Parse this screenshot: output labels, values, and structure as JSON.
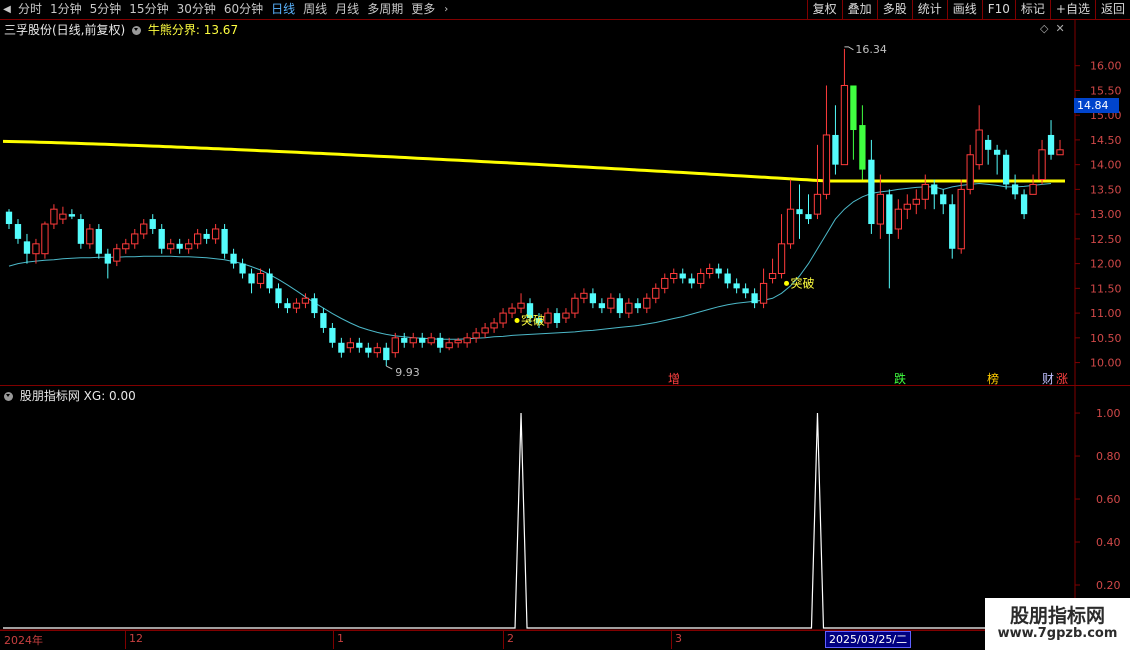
{
  "toolbar": {
    "periods": [
      "分时",
      "1分钟",
      "5分钟",
      "15分钟",
      "30分钟",
      "60分钟",
      "日线",
      "周线",
      "月线",
      "多周期",
      "更多"
    ],
    "active_period": "日线",
    "buttons": [
      "复权",
      "叠加",
      "多股",
      "统计",
      "画线",
      "F10",
      "标记",
      "+自选",
      "返回"
    ]
  },
  "main_panel": {
    "stock_title": "三孚股份(日线,前复权)",
    "indicator_label": "牛熊分界:",
    "indicator_value": "13.67",
    "high_label": "16.34",
    "low_label": "9.93",
    "current_price": "14.84",
    "breakout_labels": [
      "突破",
      "突破"
    ],
    "events": [
      "增",
      "跌",
      "榜",
      "财",
      "涨"
    ]
  },
  "sub_panel": {
    "title": "股朋指标网",
    "var_label": "XG: 0.00"
  },
  "date_axis": {
    "labels": [
      "2024年",
      "12",
      "1",
      "2",
      "3"
    ],
    "crosshair_date": "2025/03/25/二"
  },
  "watermark": {
    "name": "股朋指标网",
    "url": "www.7gpzb.com"
  },
  "colors": {
    "up": "#ff3c3c",
    "down": "#54fcfc",
    "bull_bear_line": "#ffff00",
    "ma_line": "#4cb8c8",
    "frame": "#800000"
  },
  "chart_data": [
    {
      "type": "candlestick",
      "y_ticks": [
        10.0,
        10.5,
        11.0,
        11.5,
        12.0,
        12.5,
        13.0,
        13.5,
        14.0,
        14.5,
        15.0,
        15.5,
        16.0
      ],
      "ylim": [
        9.85,
        16.6
      ],
      "bull_bear_line": {
        "start": 14.47,
        "end": 13.67
      },
      "candles": [
        [
          13.05,
          12.8,
          13.1,
          12.7
        ],
        [
          12.8,
          12.5,
          12.9,
          12.4
        ],
        [
          12.45,
          12.2,
          12.6,
          12.0
        ],
        [
          12.2,
          12.4,
          12.5,
          12.0
        ],
        [
          12.2,
          12.8,
          12.85,
          12.1
        ],
        [
          12.8,
          13.1,
          13.2,
          12.7
        ],
        [
          12.9,
          13.0,
          13.15,
          12.8
        ],
        [
          13.0,
          12.95,
          13.1,
          12.9
        ],
        [
          12.9,
          12.4,
          13.0,
          12.3
        ],
        [
          12.4,
          12.7,
          12.8,
          12.3
        ],
        [
          12.7,
          12.2,
          12.8,
          12.1
        ],
        [
          12.2,
          12.0,
          12.3,
          11.7
        ],
        [
          12.05,
          12.3,
          12.4,
          11.95
        ],
        [
          12.3,
          12.4,
          12.5,
          12.2
        ],
        [
          12.4,
          12.6,
          12.7,
          12.3
        ],
        [
          12.6,
          12.8,
          12.9,
          12.5
        ],
        [
          12.9,
          12.7,
          13.0,
          12.6
        ],
        [
          12.7,
          12.3,
          12.8,
          12.2
        ],
        [
          12.3,
          12.4,
          12.5,
          12.2
        ],
        [
          12.4,
          12.3,
          12.5,
          12.2
        ],
        [
          12.3,
          12.4,
          12.5,
          12.2
        ],
        [
          12.4,
          12.6,
          12.7,
          12.3
        ],
        [
          12.6,
          12.5,
          12.7,
          12.4
        ],
        [
          12.5,
          12.7,
          12.8,
          12.4
        ],
        [
          12.7,
          12.2,
          12.8,
          12.1
        ],
        [
          12.2,
          12.0,
          12.3,
          11.9
        ],
        [
          12.0,
          11.8,
          12.1,
          11.7
        ],
        [
          11.8,
          11.6,
          11.9,
          11.4
        ],
        [
          11.6,
          11.8,
          11.9,
          11.5
        ],
        [
          11.8,
          11.5,
          11.9,
          11.4
        ],
        [
          11.5,
          11.2,
          11.6,
          11.1
        ],
        [
          11.2,
          11.1,
          11.3,
          11.0
        ],
        [
          11.1,
          11.2,
          11.3,
          11.0
        ],
        [
          11.2,
          11.3,
          11.4,
          11.1
        ],
        [
          11.3,
          11.0,
          11.4,
          10.9
        ],
        [
          11.0,
          10.7,
          11.1,
          10.6
        ],
        [
          10.7,
          10.4,
          10.8,
          10.3
        ],
        [
          10.4,
          10.2,
          10.5,
          10.1
        ],
        [
          10.3,
          10.4,
          10.5,
          10.2
        ],
        [
          10.4,
          10.3,
          10.5,
          10.2
        ],
        [
          10.3,
          10.2,
          10.4,
          10.1
        ],
        [
          10.2,
          10.3,
          10.4,
          10.1
        ],
        [
          10.3,
          10.05,
          10.4,
          9.93
        ],
        [
          10.2,
          10.5,
          10.6,
          10.1
        ],
        [
          10.5,
          10.4,
          10.6,
          10.3
        ],
        [
          10.4,
          10.5,
          10.6,
          10.3
        ],
        [
          10.5,
          10.4,
          10.6,
          10.3
        ],
        [
          10.4,
          10.5,
          10.6,
          10.35
        ],
        [
          10.5,
          10.3,
          10.6,
          10.2
        ],
        [
          10.3,
          10.4,
          10.5,
          10.25
        ],
        [
          10.4,
          10.45,
          10.5,
          10.3
        ],
        [
          10.4,
          10.5,
          10.6,
          10.3
        ],
        [
          10.5,
          10.6,
          10.7,
          10.4
        ],
        [
          10.6,
          10.7,
          10.8,
          10.5
        ],
        [
          10.7,
          10.8,
          10.9,
          10.6
        ],
        [
          10.8,
          11.0,
          11.1,
          10.7
        ],
        [
          11.0,
          11.1,
          11.2,
          10.9
        ],
        [
          11.1,
          11.2,
          11.4,
          11.0
        ],
        [
          11.2,
          10.9,
          11.3,
          10.8
        ],
        [
          10.9,
          10.8,
          11.0,
          10.7
        ],
        [
          10.8,
          11.0,
          11.1,
          10.7
        ],
        [
          11.0,
          10.8,
          11.1,
          10.7
        ],
        [
          10.9,
          11.0,
          11.1,
          10.8
        ],
        [
          11.0,
          11.3,
          11.4,
          10.9
        ],
        [
          11.3,
          11.4,
          11.5,
          11.2
        ],
        [
          11.4,
          11.2,
          11.5,
          11.1
        ],
        [
          11.2,
          11.1,
          11.3,
          11.0
        ],
        [
          11.1,
          11.3,
          11.4,
          11.0
        ],
        [
          11.3,
          11.0,
          11.4,
          10.9
        ],
        [
          11.0,
          11.2,
          11.3,
          10.9
        ],
        [
          11.2,
          11.1,
          11.3,
          11.0
        ],
        [
          11.1,
          11.3,
          11.4,
          11.0
        ],
        [
          11.3,
          11.5,
          11.6,
          11.2
        ],
        [
          11.5,
          11.7,
          11.8,
          11.4
        ],
        [
          11.7,
          11.8,
          11.9,
          11.6
        ],
        [
          11.8,
          11.7,
          11.9,
          11.6
        ],
        [
          11.7,
          11.6,
          11.8,
          11.5
        ],
        [
          11.6,
          11.8,
          11.9,
          11.5
        ],
        [
          11.8,
          11.9,
          12.0,
          11.7
        ],
        [
          11.9,
          11.8,
          12.0,
          11.7
        ],
        [
          11.8,
          11.6,
          11.9,
          11.5
        ],
        [
          11.6,
          11.5,
          11.7,
          11.4
        ],
        [
          11.5,
          11.4,
          11.6,
          11.3
        ],
        [
          11.4,
          11.2,
          11.5,
          11.1
        ],
        [
          11.2,
          11.6,
          11.9,
          11.1
        ],
        [
          11.7,
          11.8,
          12.1,
          11.6
        ],
        [
          11.8,
          12.4,
          13.0,
          11.7
        ],
        [
          12.4,
          13.1,
          13.7,
          12.3
        ],
        [
          13.1,
          13.0,
          13.6,
          12.5
        ],
        [
          13.0,
          12.9,
          13.4,
          12.8
        ],
        [
          13.0,
          13.4,
          14.4,
          12.9
        ],
        [
          13.4,
          14.6,
          15.6,
          13.3
        ],
        [
          14.6,
          14.0,
          15.2,
          13.8
        ],
        [
          14.0,
          15.6,
          16.34,
          14.0
        ],
        [
          15.6,
          14.7,
          15.5,
          14.1
        ],
        [
          14.8,
          13.9,
          15.2,
          13.7
        ],
        [
          14.1,
          12.8,
          14.5,
          12.6
        ],
        [
          12.8,
          13.4,
          13.8,
          12.5
        ],
        [
          13.4,
          12.6,
          13.5,
          11.5
        ],
        [
          12.7,
          13.1,
          13.3,
          12.5
        ],
        [
          13.1,
          13.2,
          13.4,
          12.9
        ],
        [
          13.2,
          13.3,
          13.5,
          13.0
        ],
        [
          13.3,
          13.6,
          13.8,
          13.1
        ],
        [
          13.6,
          13.4,
          13.7,
          13.1
        ],
        [
          13.4,
          13.2,
          13.5,
          13.0
        ],
        [
          13.2,
          12.3,
          13.4,
          12.1
        ],
        [
          12.3,
          13.5,
          13.7,
          12.2
        ],
        [
          13.5,
          14.2,
          14.4,
          13.4
        ],
        [
          14.0,
          14.7,
          15.2,
          13.9
        ],
        [
          14.5,
          14.3,
          14.6,
          14.0
        ],
        [
          14.3,
          14.2,
          14.4,
          13.8
        ],
        [
          14.2,
          13.6,
          14.3,
          13.5
        ],
        [
          13.6,
          13.4,
          13.8,
          13.3
        ],
        [
          13.4,
          13.0,
          13.5,
          12.9
        ],
        [
          13.4,
          13.6,
          13.8,
          13.4
        ],
        [
          13.7,
          14.3,
          14.5,
          13.6
        ],
        [
          14.6,
          14.2,
          14.9,
          14.1
        ],
        [
          14.2,
          14.3,
          14.5,
          14.2
        ]
      ],
      "ma": [
        11.95,
        12.0,
        12.03,
        12.05,
        12.07,
        12.08,
        12.1,
        12.11,
        12.12,
        12.12,
        12.13,
        12.13,
        12.13,
        12.14,
        12.14,
        12.15,
        12.15,
        12.15,
        12.15,
        12.14,
        12.14,
        12.13,
        12.12,
        12.1,
        12.08,
        12.04,
        12.0,
        11.94,
        11.87,
        11.78,
        11.68,
        11.57,
        11.45,
        11.33,
        11.21,
        11.1,
        10.99,
        10.89,
        10.8,
        10.72,
        10.66,
        10.61,
        10.57,
        10.54,
        10.52,
        10.5,
        10.49,
        10.48,
        10.47,
        10.47,
        10.47,
        10.48,
        10.49,
        10.5,
        10.52,
        10.53,
        10.55,
        10.56,
        10.57,
        10.58,
        10.59,
        10.6,
        10.61,
        10.62,
        10.64,
        10.65,
        10.67,
        10.69,
        10.71,
        10.73,
        10.75,
        10.78,
        10.81,
        10.85,
        10.89,
        10.93,
        10.98,
        11.03,
        11.08,
        11.13,
        11.17,
        11.2,
        11.22,
        11.24,
        11.26,
        11.3,
        11.4,
        11.55,
        11.75,
        12.0,
        12.3,
        12.6,
        12.9,
        13.1,
        13.25,
        13.35,
        13.42,
        13.45,
        13.47,
        13.5,
        13.52,
        13.54,
        13.55,
        13.55,
        13.5,
        13.55,
        13.58,
        13.6,
        13.62,
        13.6,
        13.58,
        13.55,
        13.55,
        13.56,
        13.58,
        13.6,
        13.62
      ]
    },
    {
      "type": "line",
      "name": "XG",
      "y_ticks": [
        0.2,
        0.4,
        0.6,
        0.8,
        1.0
      ],
      "ylim": [
        0,
        1.07
      ],
      "spikes_at_index": [
        57,
        90
      ],
      "values_note": "0 everywhere except 1.00 at spikes"
    }
  ]
}
